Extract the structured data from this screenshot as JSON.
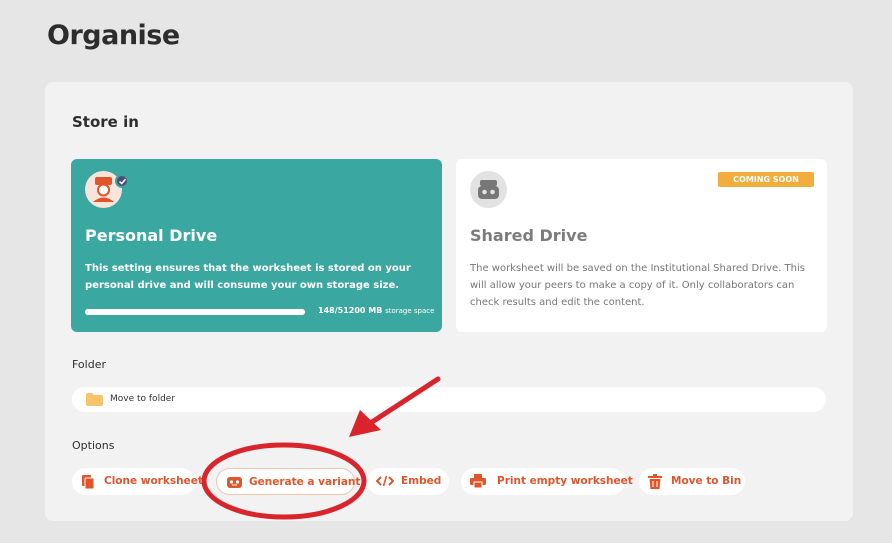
{
  "page": {
    "title": "Organise"
  },
  "store_in": {
    "title": "Store in",
    "personal": {
      "name": "Personal Drive",
      "description": "This setting ensures that the worksheet is stored on your personal drive and will consume your own storage size.",
      "storage": "148/51200 MB",
      "storage_suffix": "storage space",
      "usage_fraction": 0.003,
      "selected": true
    },
    "shared": {
      "name": "Shared Drive",
      "badge": "COMING SOON",
      "description": "The worksheet will be saved on the Institutional Shared Drive. This will allow your peers to make a copy of it. Only collaborators can check results and edit the content."
    }
  },
  "folder": {
    "label": "Folder",
    "value": "Move to folder"
  },
  "options": {
    "label": "Options",
    "buttons": [
      {
        "label": "Clone worksheet",
        "icon": "clone-icon"
      },
      {
        "label": "Generate a variant",
        "icon": "robot-icon"
      },
      {
        "label": "Embed",
        "icon": "code-icon"
      },
      {
        "label": "Print empty worksheet",
        "icon": "printer-icon"
      },
      {
        "label": "Move to Bin",
        "icon": "trash-icon"
      }
    ]
  },
  "colors": {
    "accent": "#e0552a",
    "personal_card": "#3aa8a0",
    "badge": "#f2ad3c",
    "annotation": "#d9242b"
  }
}
